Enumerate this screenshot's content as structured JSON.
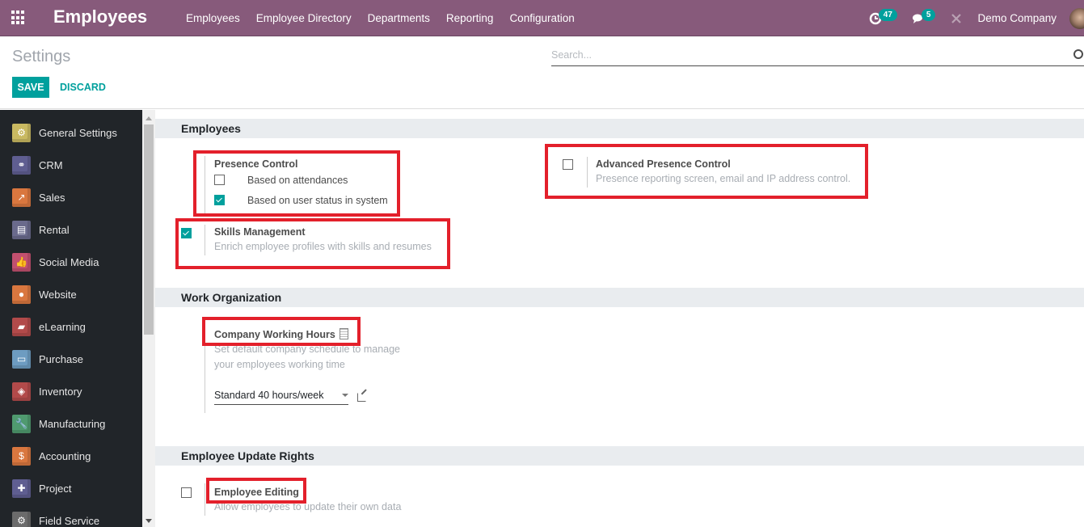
{
  "topbar": {
    "app_title": "Employees",
    "menu": [
      "Employees",
      "Employee Directory",
      "Departments",
      "Reporting",
      "Configuration"
    ],
    "activity_count": "47",
    "message_count": "5",
    "company": "Demo Company",
    "icons": {
      "apps": "grid-icon",
      "activity": "clock-icon",
      "messages": "chat-icon",
      "debug": "tools-icon",
      "user": "avatar"
    }
  },
  "control_panel": {
    "title": "Settings",
    "save_label": "SAVE",
    "discard_label": "DISCARD",
    "search_placeholder": "Search..."
  },
  "sidebar": {
    "items": [
      {
        "label": "General Settings",
        "icon": "gear-icon",
        "color": "#c9b961",
        "glyph": "⚙"
      },
      {
        "label": "CRM",
        "icon": "handshake-icon",
        "color": "#5f5e91",
        "glyph": "⚭"
      },
      {
        "label": "Sales",
        "icon": "chart-icon",
        "color": "#d9773f",
        "glyph": "↗"
      },
      {
        "label": "Rental",
        "icon": "rental-icon",
        "color": "#6a6a8c",
        "glyph": "▤"
      },
      {
        "label": "Social Media",
        "icon": "thumbs-up-icon",
        "color": "#c2506f",
        "glyph": "👍"
      },
      {
        "label": "Website",
        "icon": "globe-icon",
        "color": "#d9773f",
        "glyph": "●"
      },
      {
        "label": "eLearning",
        "icon": "elearning-icon",
        "color": "#b24a4a",
        "glyph": "▰"
      },
      {
        "label": "Purchase",
        "icon": "credit-card-icon",
        "color": "#6d9cc1",
        "glyph": "▭"
      },
      {
        "label": "Inventory",
        "icon": "box-icon",
        "color": "#b24a4a",
        "glyph": "◈"
      },
      {
        "label": "Manufacturing",
        "icon": "wrench-icon",
        "color": "#4f9a6f",
        "glyph": "🔧"
      },
      {
        "label": "Accounting",
        "icon": "invoice-icon",
        "color": "#d9773f",
        "glyph": "$"
      },
      {
        "label": "Project",
        "icon": "puzzle-icon",
        "color": "#5f5e91",
        "glyph": "✚"
      },
      {
        "label": "Field Service",
        "icon": "field-service-icon",
        "color": "#6b6b6b",
        "glyph": "⚙"
      }
    ]
  },
  "sections": {
    "employees": {
      "heading": "Employees",
      "presence_control": {
        "title": "Presence Control",
        "options": [
          {
            "label": "Based on attendances",
            "checked": false
          },
          {
            "label": "Based on user status in system",
            "checked": true
          }
        ]
      },
      "advanced_presence": {
        "title": "Advanced Presence Control",
        "description": "Presence reporting screen, email and IP address control.",
        "checked": false
      },
      "skills": {
        "title": "Skills Management",
        "description": "Enrich employee profiles with skills and resumes",
        "checked": true
      }
    },
    "work_org": {
      "heading": "Work Organization",
      "working_hours": {
        "title": "Company Working Hours",
        "description_1": "Set default company schedule to manage",
        "description_2": "your employees working time",
        "selected": "Standard 40 hours/week"
      }
    },
    "update_rights": {
      "heading": "Employee Update Rights",
      "editing": {
        "title": "Employee Editing",
        "description": "Allow employees to update their own data",
        "checked": false
      }
    }
  }
}
